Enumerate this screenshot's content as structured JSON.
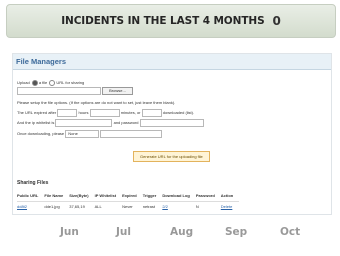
{
  "header": {
    "title": "INCIDENTS IN THE LAST 4 MONTHS",
    "count": "0"
  },
  "file_manager": {
    "title": "File Managers",
    "upload_label": "Upload",
    "radio_file": "a file",
    "radio_url": "URL for sharing",
    "browse": "Browse...",
    "instructions": "Please setup the file options. (If the options are do not want to set, just leave them blank).",
    "expire_prefix": "The URL expired after",
    "expire_hours": "hours",
    "expire_minutes": "minutes, or",
    "expire_downloads": "downloaded (list).",
    "ip_label": "And the ip whitelist is",
    "password_label": "and password",
    "trigger_label": "Once downloading, please",
    "trigger_option": "None",
    "generate_button": "Generate URL for the uploading file"
  },
  "sharing": {
    "title": "Sharing Files",
    "columns": [
      "Public URL",
      "File Name",
      "Size(Byte)",
      "IP Whitelist",
      "Expired",
      "Trigger",
      "Download Log",
      "Password",
      "Action"
    ],
    "rows": [
      [
        "dd8t2",
        "dde1.jpg",
        "37,65,19",
        "ALL",
        "Never",
        "netrast",
        "2/2",
        "N",
        "Delete"
      ]
    ]
  },
  "months": [
    "Jun",
    "Jul",
    "Aug",
    "Sep",
    "Oct"
  ],
  "colors": {
    "link": "#2962a8",
    "panel_title": "#3d6a9a",
    "generate_bg": "#fff4d6"
  }
}
